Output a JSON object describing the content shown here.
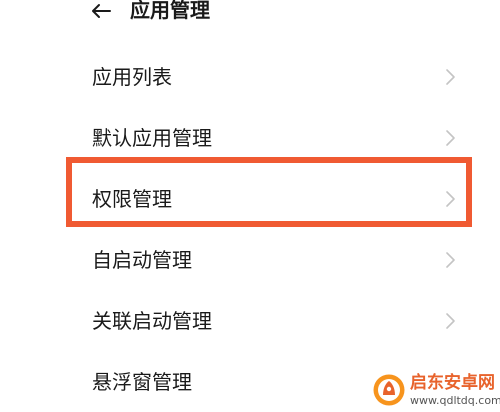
{
  "header": {
    "back_icon": "arrow-left-icon",
    "title": "应用管理"
  },
  "menu": {
    "items": [
      {
        "label": "应用列表",
        "highlighted": false
      },
      {
        "label": "默认应用管理",
        "highlighted": false
      },
      {
        "label": "权限管理",
        "highlighted": true
      },
      {
        "label": "自启动管理",
        "highlighted": false
      },
      {
        "label": "关联启动管理",
        "highlighted": false
      },
      {
        "label": "悬浮窗管理",
        "highlighted": false
      }
    ],
    "chevron_icon": "chevron-right-icon"
  },
  "highlight": {
    "color": "#f05a32"
  },
  "watermark": {
    "name": "启东安卓网",
    "url": "www.qdltdq.com"
  },
  "colors": {
    "text": "#1a1a1a",
    "chevron": "#c4c4c4",
    "accent": "#f05a32"
  }
}
